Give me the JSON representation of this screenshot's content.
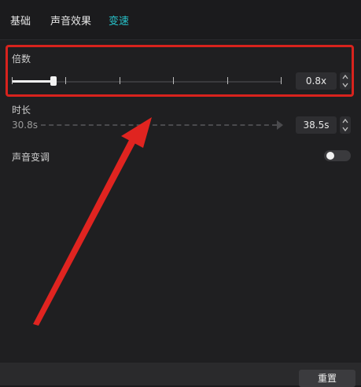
{
  "tabs": [
    {
      "label": "基础"
    },
    {
      "label": "声音效果"
    },
    {
      "label": "变速"
    }
  ],
  "active_tab": "变速",
  "speed": {
    "label": "倍数",
    "value_text": "0.8x",
    "slider_fraction": 0.155
  },
  "duration": {
    "label": "时长",
    "start_text": "30.8s",
    "value_text": "38.5s"
  },
  "pitch": {
    "label": "声音变调",
    "enabled": false
  },
  "footer": {
    "reset_label": "重置"
  },
  "colors": {
    "accent": "#27c2c9",
    "highlight_box": "#d8231d",
    "annotation_arrow": "#e02420"
  }
}
